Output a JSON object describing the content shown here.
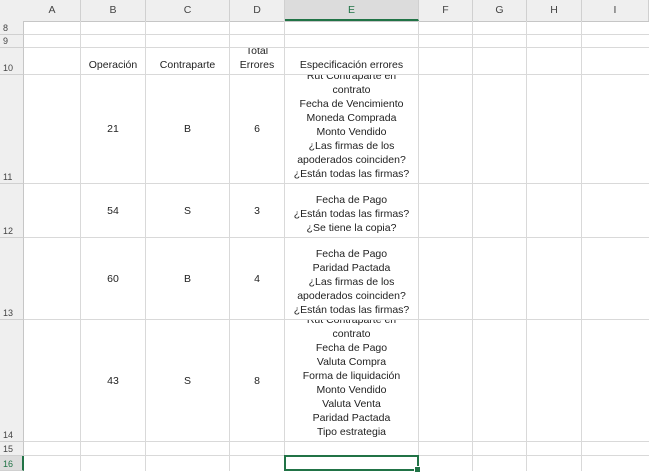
{
  "columns": [
    "A",
    "B",
    "C",
    "D",
    "E",
    "F",
    "G",
    "H",
    "I"
  ],
  "rows": [
    "8",
    "9",
    "10",
    "11",
    "12",
    "13",
    "14",
    "15",
    "16"
  ],
  "header_row": {
    "operacion": "Operación",
    "contraparte": "Contraparte",
    "total_errores_line1": "Total",
    "total_errores_line2": "Errores",
    "especificacion": "Especificación errores"
  },
  "records": [
    {
      "operacion": "21",
      "contraparte": "B",
      "total": "6",
      "errores": [
        "Rut Contraparte en",
        "contrato",
        "Fecha de Vencimiento",
        "Moneda Comprada",
        "Monto Vendido",
        "¿Las firmas de los",
        "apoderados coinciden?",
        "¿Están todas las firmas?"
      ]
    },
    {
      "operacion": "54",
      "contraparte": "S",
      "total": "3",
      "errores": [
        "Fecha de Pago",
        "¿Están todas las firmas?",
        "¿Se tiene la copia?"
      ]
    },
    {
      "operacion": "60",
      "contraparte": "B",
      "total": "4",
      "errores": [
        "Fecha de Pago",
        "Paridad Pactada",
        "¿Las firmas de los",
        "apoderados coinciden?",
        "¿Están todas las firmas?"
      ]
    },
    {
      "operacion": "43",
      "contraparte": "S",
      "total": "8",
      "errores": [
        "Rut Contraparte en",
        "contrato",
        "Fecha de Pago",
        "Valuta Compra",
        "Forma de liquidación",
        "Monto Vendido",
        "Valuta Venta",
        "Paridad Pactada",
        "Tipo estrategia"
      ]
    }
  ],
  "selected_cell": "E16",
  "accent_color": "#217346"
}
